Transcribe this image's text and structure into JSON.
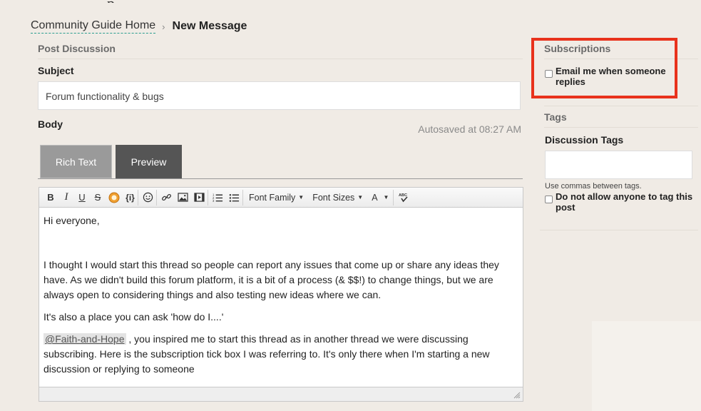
{
  "breadcrumb": {
    "home_label": "Community Guide Home",
    "separator": "›",
    "current": "New Message"
  },
  "post": {
    "section_title": "Post Discussion",
    "subject_label": "Subject",
    "subject_value": "Forum functionality & bugs",
    "body_label": "Body",
    "autosave_text": "Autosaved at 08:27 AM",
    "tabs": [
      {
        "label": "Rich Text",
        "active": false
      },
      {
        "label": "Preview",
        "active": true
      }
    ]
  },
  "toolbar": {
    "bold": "B",
    "italic": "I",
    "underline": "U",
    "strikethrough": "S",
    "code": "{i}",
    "font_family": "Font Family",
    "font_sizes": "Font Sizes",
    "text_color": "A",
    "spellcheck": "ABC"
  },
  "body": {
    "greeting": "Hi everyone,",
    "paragraph1": "I thought I would start this thread so people can report any issues that come up or share any ideas they have. As we didn't build this forum platform, it is a bit of a process (& $$!) to change things, but we are always open to considering things and also testing new ideas where we can.",
    "paragraph2": "It's also a place you can ask 'how do I....'",
    "mention": "@Faith-and-Hope",
    "paragraph3": " , you inspired me to start this thread as in another thread we were discussing subscribing. Here is the subscription tick box I was referring to. It's only there when I'm starting a new discussion or replying to someone"
  },
  "subscriptions": {
    "title": "Subscriptions",
    "email_label": "Email me when someone replies",
    "email_checked": false,
    "highlight_color": "#e8321c"
  },
  "tags": {
    "title": "Tags",
    "discussion_tags_label": "Discussion Tags",
    "discussion_tags_value": "",
    "hint": "Use commas between tags.",
    "no_tag_label": "Do not allow anyone to tag this post",
    "no_tag_checked": false
  }
}
